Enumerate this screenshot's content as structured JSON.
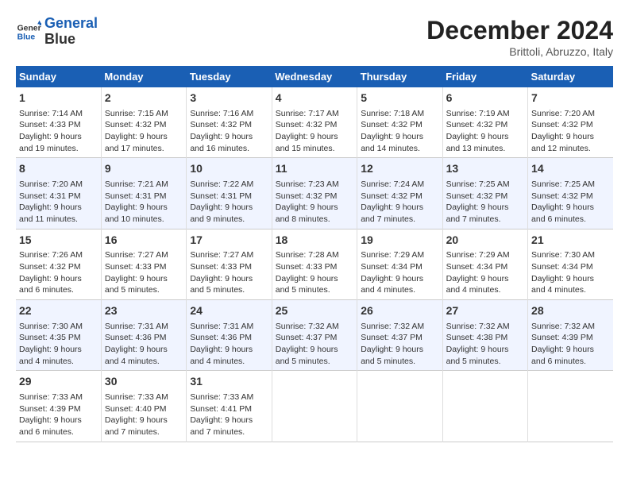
{
  "header": {
    "logo_line1": "General",
    "logo_line2": "Blue",
    "month": "December 2024",
    "location": "Brittoli, Abruzzo, Italy"
  },
  "days_of_week": [
    "Sunday",
    "Monday",
    "Tuesday",
    "Wednesday",
    "Thursday",
    "Friday",
    "Saturday"
  ],
  "weeks": [
    [
      {
        "day": "1",
        "text": "Sunrise: 7:14 AM\nSunset: 4:33 PM\nDaylight: 9 hours and 19 minutes."
      },
      {
        "day": "2",
        "text": "Sunrise: 7:15 AM\nSunset: 4:32 PM\nDaylight: 9 hours and 17 minutes."
      },
      {
        "day": "3",
        "text": "Sunrise: 7:16 AM\nSunset: 4:32 PM\nDaylight: 9 hours and 16 minutes."
      },
      {
        "day": "4",
        "text": "Sunrise: 7:17 AM\nSunset: 4:32 PM\nDaylight: 9 hours and 15 minutes."
      },
      {
        "day": "5",
        "text": "Sunrise: 7:18 AM\nSunset: 4:32 PM\nDaylight: 9 hours and 14 minutes."
      },
      {
        "day": "6",
        "text": "Sunrise: 7:19 AM\nSunset: 4:32 PM\nDaylight: 9 hours and 13 minutes."
      },
      {
        "day": "7",
        "text": "Sunrise: 7:20 AM\nSunset: 4:32 PM\nDaylight: 9 hours and 12 minutes."
      }
    ],
    [
      {
        "day": "8",
        "text": "Sunrise: 7:20 AM\nSunset: 4:31 PM\nDaylight: 9 hours and 11 minutes."
      },
      {
        "day": "9",
        "text": "Sunrise: 7:21 AM\nSunset: 4:31 PM\nDaylight: 9 hours and 10 minutes."
      },
      {
        "day": "10",
        "text": "Sunrise: 7:22 AM\nSunset: 4:31 PM\nDaylight: 9 hours and 9 minutes."
      },
      {
        "day": "11",
        "text": "Sunrise: 7:23 AM\nSunset: 4:32 PM\nDaylight: 9 hours and 8 minutes."
      },
      {
        "day": "12",
        "text": "Sunrise: 7:24 AM\nSunset: 4:32 PM\nDaylight: 9 hours and 7 minutes."
      },
      {
        "day": "13",
        "text": "Sunrise: 7:25 AM\nSunset: 4:32 PM\nDaylight: 9 hours and 7 minutes."
      },
      {
        "day": "14",
        "text": "Sunrise: 7:25 AM\nSunset: 4:32 PM\nDaylight: 9 hours and 6 minutes."
      }
    ],
    [
      {
        "day": "15",
        "text": "Sunrise: 7:26 AM\nSunset: 4:32 PM\nDaylight: 9 hours and 6 minutes."
      },
      {
        "day": "16",
        "text": "Sunrise: 7:27 AM\nSunset: 4:33 PM\nDaylight: 9 hours and 5 minutes."
      },
      {
        "day": "17",
        "text": "Sunrise: 7:27 AM\nSunset: 4:33 PM\nDaylight: 9 hours and 5 minutes."
      },
      {
        "day": "18",
        "text": "Sunrise: 7:28 AM\nSunset: 4:33 PM\nDaylight: 9 hours and 5 minutes."
      },
      {
        "day": "19",
        "text": "Sunrise: 7:29 AM\nSunset: 4:34 PM\nDaylight: 9 hours and 4 minutes."
      },
      {
        "day": "20",
        "text": "Sunrise: 7:29 AM\nSunset: 4:34 PM\nDaylight: 9 hours and 4 minutes."
      },
      {
        "day": "21",
        "text": "Sunrise: 7:30 AM\nSunset: 4:34 PM\nDaylight: 9 hours and 4 minutes."
      }
    ],
    [
      {
        "day": "22",
        "text": "Sunrise: 7:30 AM\nSunset: 4:35 PM\nDaylight: 9 hours and 4 minutes."
      },
      {
        "day": "23",
        "text": "Sunrise: 7:31 AM\nSunset: 4:36 PM\nDaylight: 9 hours and 4 minutes."
      },
      {
        "day": "24",
        "text": "Sunrise: 7:31 AM\nSunset: 4:36 PM\nDaylight: 9 hours and 4 minutes."
      },
      {
        "day": "25",
        "text": "Sunrise: 7:32 AM\nSunset: 4:37 PM\nDaylight: 9 hours and 5 minutes."
      },
      {
        "day": "26",
        "text": "Sunrise: 7:32 AM\nSunset: 4:37 PM\nDaylight: 9 hours and 5 minutes."
      },
      {
        "day": "27",
        "text": "Sunrise: 7:32 AM\nSunset: 4:38 PM\nDaylight: 9 hours and 5 minutes."
      },
      {
        "day": "28",
        "text": "Sunrise: 7:32 AM\nSunset: 4:39 PM\nDaylight: 9 hours and 6 minutes."
      }
    ],
    [
      {
        "day": "29",
        "text": "Sunrise: 7:33 AM\nSunset: 4:39 PM\nDaylight: 9 hours and 6 minutes."
      },
      {
        "day": "30",
        "text": "Sunrise: 7:33 AM\nSunset: 4:40 PM\nDaylight: 9 hours and 7 minutes."
      },
      {
        "day": "31",
        "text": "Sunrise: 7:33 AM\nSunset: 4:41 PM\nDaylight: 9 hours and 7 minutes."
      },
      {
        "day": "",
        "text": ""
      },
      {
        "day": "",
        "text": ""
      },
      {
        "day": "",
        "text": ""
      },
      {
        "day": "",
        "text": ""
      }
    ]
  ]
}
